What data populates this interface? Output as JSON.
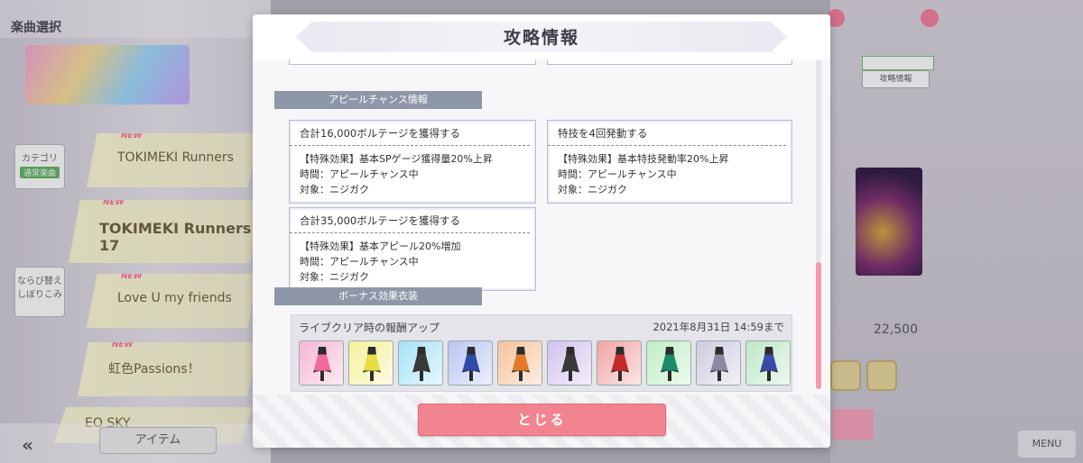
{
  "background": {
    "screen_title": "楽曲選択",
    "category": {
      "label": "カテゴリ",
      "value": "通常楽曲"
    },
    "sort_label": "ならび替え しぼりこみ",
    "new_badge": "NEW",
    "songs": [
      {
        "title": "TOKIMEKI Runners"
      },
      {
        "title": "TOKIMEKI Runners 17"
      },
      {
        "title": "Love U my friends"
      },
      {
        "title": "虹色Passions！"
      },
      {
        "title": "EO SKY"
      }
    ],
    "back_label": "«",
    "item_label": "アイテム",
    "info_label": "攻略情報",
    "score": "22,500",
    "menu_label": "MENU"
  },
  "dialog": {
    "title": "攻略情報",
    "section_appeal": "アピールチャンス情報",
    "section_costume": "ボーナス効果衣装",
    "appeal_cards": [
      {
        "title": "合計16,000ボルテージを獲得する",
        "effect": "【特殊効果】基本SPゲージ獲得量20%上昇",
        "time": "時間：アピールチャンス中",
        "target": "対象：ニジガク"
      },
      {
        "title": "特技を4回発動する",
        "effect": "【特殊効果】基本特技発動率20%上昇",
        "time": "時間：アピールチャンス中",
        "target": "対象：ニジガク"
      },
      {
        "title": "合計35,000ボルテージを獲得する",
        "effect": "【特殊効果】基本アピール20%増加",
        "time": "時間：アピールチャンス中",
        "target": "対象：ニジガク"
      }
    ],
    "costume_box": {
      "title": "ライブクリア時の報酬アップ",
      "deadline": "2021年8月31日 14:59まで",
      "costumes": [
        {
          "bg": "#f7b6d4",
          "dress": "#f06a9a"
        },
        {
          "bg": "#f4f29a",
          "dress": "#e7dd45"
        },
        {
          "bg": "#a6e2f5",
          "dress": "#3a3a3a"
        },
        {
          "bg": "#b9c6f2",
          "dress": "#2f4aa8"
        },
        {
          "bg": "#f7c29a",
          "dress": "#e27a2a"
        },
        {
          "bg": "#d3c2ee",
          "dress": "#3a3a3a"
        },
        {
          "bg": "#f2a4a4",
          "dress": "#c52a2a"
        },
        {
          "bg": "#bfeec4",
          "dress": "#1a8a6a"
        },
        {
          "bg": "#cfcbe0",
          "dress": "#8a8aa0"
        },
        {
          "bg": "#bde8c6",
          "dress": "#3a4aa8"
        }
      ]
    },
    "close_label": "とじる",
    "scroll_progress": 0.62
  }
}
